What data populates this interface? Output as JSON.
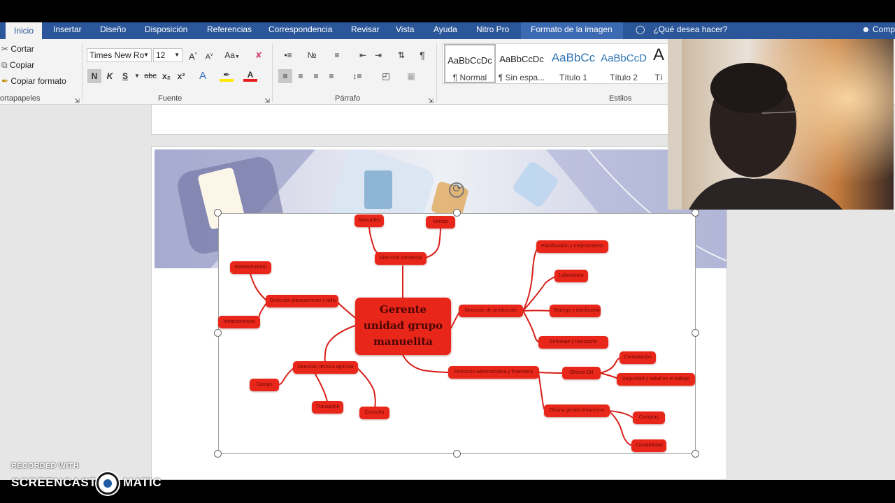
{
  "ribbon_tabs": [
    {
      "label": "Inicio",
      "active": true
    },
    {
      "label": "Insertar"
    },
    {
      "label": "Diseño"
    },
    {
      "label": "Disposición"
    },
    {
      "label": "Referencias"
    },
    {
      "label": "Correspondencia"
    },
    {
      "label": "Revisar"
    },
    {
      "label": "Vista"
    },
    {
      "label": "Ayuda"
    },
    {
      "label": "Nitro Pro"
    },
    {
      "label": "Formato de la imagen"
    }
  ],
  "tell_me": "¿Qué desea hacer?",
  "share": "Comp",
  "clipboard": {
    "cut": "Cortar",
    "copy": "Copiar",
    "format_painter": "Copiar formato",
    "group_label": "ortapapeles"
  },
  "font": {
    "name": "Times New Ro",
    "size": "12",
    "grow": "A",
    "shrink": "A",
    "change_case": "Aa",
    "bold": "N",
    "italic": "K",
    "underline": "S",
    "strike": "abc",
    "subscript": "x₂",
    "superscript": "x²",
    "group_label": "Fuente"
  },
  "paragraph": {
    "group_label": "Párrafo",
    "pilcrow": "¶"
  },
  "styles": {
    "group_label": "Estilos",
    "items": [
      {
        "sample": "AaBbCcDc",
        "name": "¶ Normal"
      },
      {
        "sample": "AaBbCcDc",
        "name": "¶ Sin espa..."
      },
      {
        "sample": "AaBbCc",
        "name": "Título 1"
      },
      {
        "sample": "AaBbCcD",
        "name": "Título 2"
      },
      {
        "sample": "A",
        "name": "Tí"
      }
    ]
  },
  "mindmap": {
    "center": [
      "Gerente",
      "unidad grupo",
      "manuelita"
    ],
    "nodes": [
      {
        "id": "mercadeo",
        "label": "Mercadeo"
      },
      {
        "id": "ventas",
        "label": "Ventas"
      },
      {
        "id": "dir_comercial",
        "label": "Dirección comercial"
      },
      {
        "id": "mantenimiento",
        "label": "Mantenimiento"
      },
      {
        "id": "dir_planeamiento",
        "label": "Dirección planeamiento y taller"
      },
      {
        "id": "infraestructura",
        "label": "Infraestructura"
      },
      {
        "id": "dir_produccion",
        "label": "Dirección de producción"
      },
      {
        "id": "planificacion",
        "label": "Planificación y mejoramiento"
      },
      {
        "id": "laboratorio",
        "label": "Laboratorio"
      },
      {
        "id": "bodega",
        "label": "Bodega y distribución"
      },
      {
        "id": "embalaje",
        "label": "Embalaje y transporte"
      },
      {
        "id": "dir_tecnica",
        "label": "Dirección técnica agrícola"
      },
      {
        "id": "campo",
        "label": "Campo"
      },
      {
        "id": "transporte",
        "label": "Transporte"
      },
      {
        "id": "cosecha",
        "label": "Cosecha"
      },
      {
        "id": "dir_admin",
        "label": "Dirección administrativa y financiera"
      },
      {
        "id": "oficina_gh",
        "label": "Oficina GH"
      },
      {
        "id": "contratacion",
        "label": "Contratación"
      },
      {
        "id": "seguridad",
        "label": "Seguridad y salud en el trabajo"
      },
      {
        "id": "oficina_gf",
        "label": "Oficina gestión financiera"
      },
      {
        "id": "compras",
        "label": "Compras"
      },
      {
        "id": "contabilidad",
        "label": "Contabilidad"
      }
    ]
  },
  "watermark": {
    "line1": "RECORDED WITH",
    "brand_left": "SCREENCAST",
    "brand_right": "MATIC"
  }
}
